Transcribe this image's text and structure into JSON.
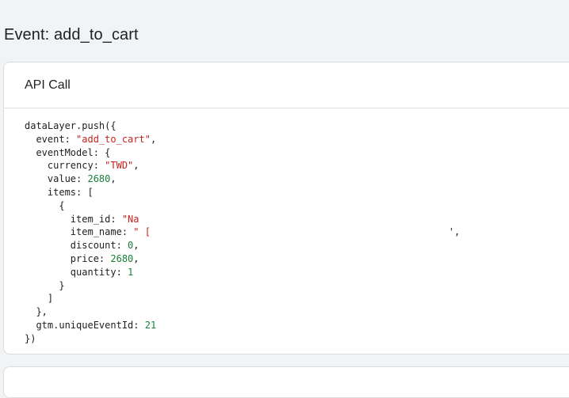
{
  "page": {
    "title": "Event: add_to_cart"
  },
  "api_card": {
    "title": "API Call",
    "code": {
      "l1": "dataLayer.push({",
      "event_key": "  event: ",
      "event_val": "\"add_to_cart\"",
      "event_end": ",",
      "eventmodel": "  eventModel: {",
      "currency_key": "    currency: ",
      "currency_val": "\"TWD\"",
      "currency_end": ",",
      "value_key": "    value: ",
      "value_val": "2680",
      "value_end": ",",
      "items": "    items: [",
      "obj_open": "      {",
      "item_id_key": "        item_id: ",
      "item_id_val": "\"Na",
      "item_name_key": "        item_name: ",
      "item_name_val": "\" [",
      "item_name_tail": "',",
      "discount_key": "        discount: ",
      "discount_val": "0",
      "discount_end": ",",
      "price_key": "        price: ",
      "price_val": "2680",
      "price_end": ",",
      "quantity_key": "        quantity: ",
      "quantity_val": "1",
      "obj_close": "      }",
      "arr_close": "    ]",
      "model_close": "  },",
      "gtm_key": "  gtm.uniqueEventId: ",
      "gtm_val": "21",
      "end": "})"
    }
  },
  "colors": {
    "string": "#c5221f",
    "number": "#188038",
    "text": "#202124",
    "background": "#f1f3f4"
  }
}
